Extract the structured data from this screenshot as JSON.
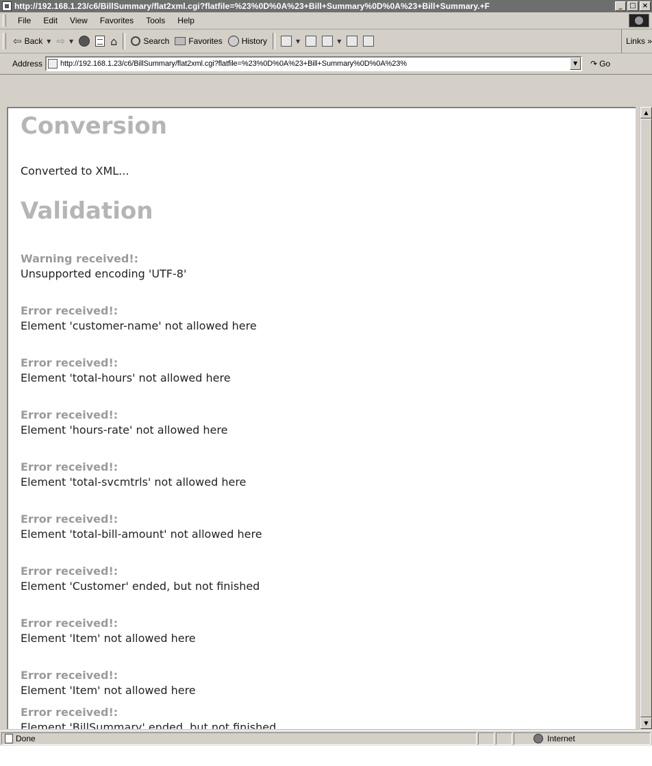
{
  "window": {
    "title": "http://192.168.1.23/c6/BillSummary/flat2xml.cgi?flatfile=%23%0D%0A%23+Bill+Summary%0D%0A%23+Bill+Summary.+F",
    "buttons": {
      "minimize": "_",
      "maximize": "□",
      "close": "×"
    }
  },
  "menu": {
    "items": [
      {
        "label": "File"
      },
      {
        "label": "Edit"
      },
      {
        "label": "View"
      },
      {
        "label": "Favorites"
      },
      {
        "label": "Tools"
      },
      {
        "label": "Help"
      }
    ]
  },
  "toolbar": {
    "back_label": "Back",
    "search_label": "Search",
    "favorites_label": "Favorites",
    "history_label": "History",
    "links_label": "Links »"
  },
  "address": {
    "label": "Address",
    "url": "http://192.168.1.23/c6/BillSummary/flat2xml.cgi?flatfile=%23%0D%0A%23+Bill+Summary%0D%0A%23%",
    "go_label": "Go"
  },
  "content": {
    "conversion_heading": "Conversion",
    "conversion_text": "Converted to XML...",
    "validation_heading": "Validation",
    "messages": [
      {
        "label": "Warning received!:",
        "text": "Unsupported encoding 'UTF-8'"
      },
      {
        "label": "Error received!:",
        "text": "Element 'customer-name' not allowed here"
      },
      {
        "label": "Error received!:",
        "text": "Element 'total-hours' not allowed here"
      },
      {
        "label": "Error received!:",
        "text": "Element 'hours-rate' not allowed here"
      },
      {
        "label": "Error received!:",
        "text": "Element 'total-svcmtrls' not allowed here"
      },
      {
        "label": "Error received!:",
        "text": "Element 'total-bill-amount' not allowed here"
      },
      {
        "label": "Error received!:",
        "text": "Element 'Customer' ended, but not finished"
      },
      {
        "label": "Error received!:",
        "text": "Element 'Item' not allowed here"
      },
      {
        "label": "Error received!:",
        "text": "Element 'Item' not allowed here"
      },
      {
        "label": "Error received!:",
        "text": "Element 'BillSummary' ended, but not finished"
      }
    ]
  },
  "status": {
    "text": "Done",
    "zone": "Internet"
  }
}
